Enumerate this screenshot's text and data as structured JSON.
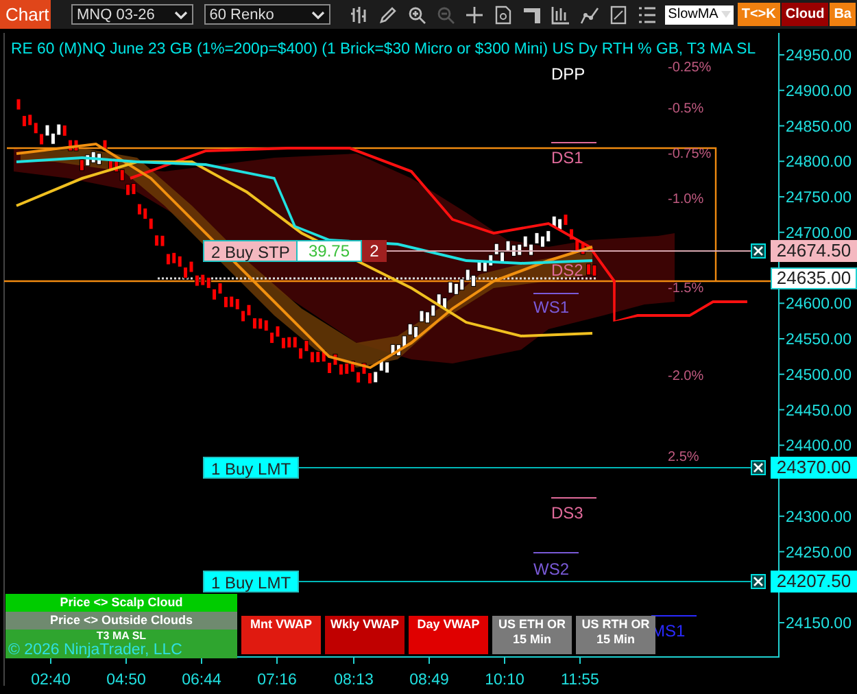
{
  "toolbar": {
    "title": "Chart",
    "instrument": "MNQ 03-26",
    "period": "60 Renko",
    "indicator_select": "SlowMA",
    "buttons": [
      {
        "label": "T<>K",
        "kind": "orange"
      },
      {
        "label": "Cloud",
        "kind": "red"
      },
      {
        "label": "Ba",
        "kind": "orange"
      }
    ]
  },
  "chart": {
    "title": "RE 60 (M)NQ June 23 GB (1%=200p=$400) (1 Brick=$30 Micro or $300 Mini)  US Dy RTH % GB, T3 MA SL",
    "percent_levels": [
      "-0.25%",
      "-0.5%",
      "-0.75%",
      "-1.0%",
      "-1.5%",
      "-2.0%",
      "2.5%"
    ],
    "pivot_labels": [
      {
        "label": "DPP",
        "kind": "daily"
      },
      {
        "label": "DS1",
        "kind": "daily"
      },
      {
        "label": "DS2",
        "kind": "daily"
      },
      {
        "label": "WS1",
        "kind": "weekly"
      },
      {
        "label": "DS3",
        "kind": "daily"
      },
      {
        "label": "WS2",
        "kind": "weekly"
      },
      {
        "label": "MS1",
        "kind": "monthly"
      }
    ],
    "orders": [
      {
        "kind": "stop",
        "label": "2 Buy STP",
        "value": "39.75",
        "quantity": "2",
        "marker": "24674.50"
      },
      {
        "kind": "limit",
        "label": "1 Buy LMT",
        "marker": "24370.00"
      },
      {
        "kind": "limit",
        "label": "1 Buy LMT",
        "marker": "24207.50"
      }
    ],
    "last_price": "24635.00",
    "price_ticks": [
      "24950.00",
      "24900.00",
      "24850.00",
      "24800.00",
      "24750.00",
      "24700.00",
      "24600.00",
      "24550.00",
      "24500.00",
      "24450.00",
      "24400.00",
      "24300.00",
      "24250.00",
      "24150.00"
    ],
    "time_ticks": [
      "02:40",
      "04:50",
      "06:44",
      "07:16",
      "08:13",
      "08:49",
      "10:10",
      "11:55"
    ],
    "status_panels": [
      {
        "label": "Price <> Scalp Cloud",
        "color": "#00cc00"
      },
      {
        "label": "Price <> Outside Clouds",
        "color": "#6f8a6f"
      },
      {
        "label": "T3 MA SL",
        "color": "#2fa52f"
      }
    ],
    "copyright": "© 2026 NinjaTrader, LLC",
    "indicator_buttons": [
      {
        "label": "Mnt VWAP",
        "color": "#e01a10"
      },
      {
        "label": "Wkly VWAP",
        "color": "#c00000"
      },
      {
        "label": "Day VWAP",
        "color": "#e00000"
      },
      {
        "label": "US ETH OR 15 Min",
        "color": "#7a7a7a"
      },
      {
        "label": "US RTH OR 15 Min",
        "color": "#7a7a7a"
      }
    ]
  }
}
